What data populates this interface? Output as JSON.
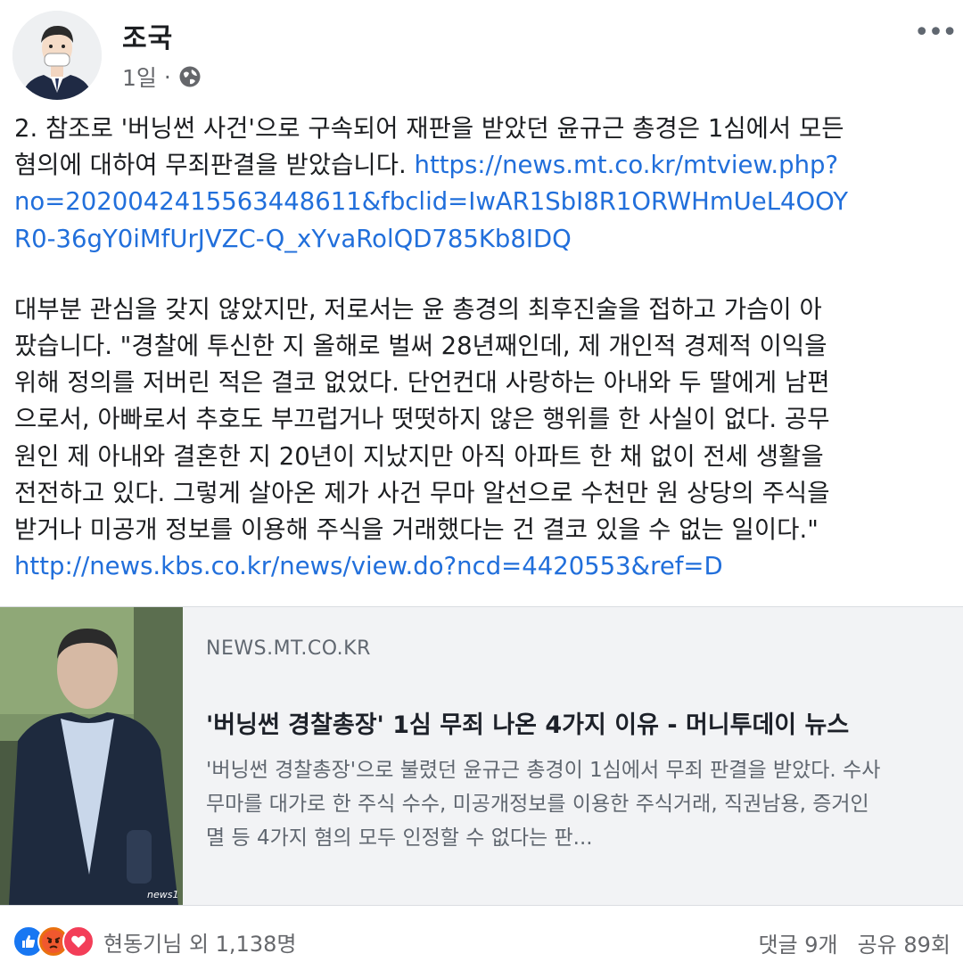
{
  "post": {
    "author": "조국",
    "time": "1일",
    "privacy_icon": "globe-icon",
    "more_icon": "more-icon",
    "body": {
      "p1": [
        "2. 참조로 '버닝썬 사건'으로 구속되어 재판을 받았던 윤규근 총경은 1심에서 모든",
        "혐의에 대하여 무죄판결을 받았습니다. "
      ],
      "p1_link": [
        "https://news.mt.co.kr/mtview.php?",
        "no=2020042415563448611&fbclid=IwAR1SbI8R1ORWHmUeL4OOY",
        "R0-36gY0iMfUrJVZC-Q_xYvaRolQD785Kb8IDQ"
      ],
      "p2": [
        "대부분 관심을 갖지 않았지만, 저로서는 윤 총경의 최후진술을 접하고 가슴이 아",
        "팠습니다. \"경찰에 투신한 지 올해로 벌써 28년째인데, 제 개인적 경제적 이익을",
        "위해 정의를 저버린 적은 결코 없었다. 단언컨대 사랑하는 아내와 두 딸에게 남편",
        "으로서, 아빠로서 추호도 부끄럽거나 떳떳하지 않은 행위를 한 사실이 없다. 공무",
        "원인 제 아내와 결혼한 지 20년이 지났지만 아직 아파트 한 채 없이 전세 생활을",
        "전전하고 있다. 그렇게 살아온 제가 사건 무마 알선으로 수천만 원 상당의 주식을",
        "받거나 미공개 정보를 이용해 주식을 거래했다는 건 결코 있을 수 없는 일이다.\""
      ],
      "p2_link": "http://news.kbs.co.kr/news/view.do?ncd=4420553&ref=D"
    }
  },
  "link_card": {
    "domain": "NEWS.MT.CO.KR",
    "title": "'버닝썬 경찰총장' 1심 무죄 나온 4가지 이유 - 머니투데이 뉴스",
    "description": [
      "'버닝썬 경찰총장'으로 불렸던 윤규근 총경이 1심에서 무죄 판결을 받았다. 수사",
      "무마를 대가로 한 주식 수수, 미공개정보를 이용한 주식거래, 직권남용, 증거인",
      "멸 등 4가지 혐의 모두 인정할 수 없다는 판..."
    ],
    "thumb_watermark": "news1"
  },
  "footer": {
    "reaction_icons": [
      "like-icon",
      "angry-icon",
      "love-icon"
    ],
    "reaction_text": "현동기님 외 1,138명",
    "comments": "댓글 9개",
    "shares": "공유 89회"
  },
  "colors": {
    "link": "#216fdb",
    "like": "#1877f2",
    "angry": "#e9710f",
    "love": "#f33e58"
  }
}
